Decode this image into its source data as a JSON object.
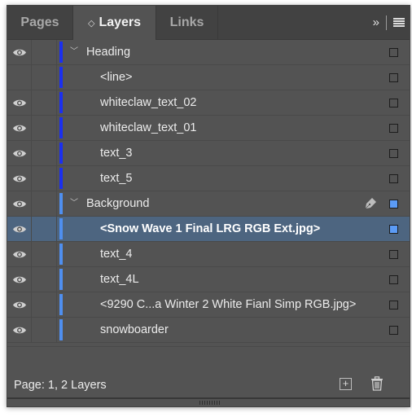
{
  "tabs": [
    {
      "label": "Pages",
      "active": false
    },
    {
      "label": "Layers",
      "active": true,
      "icon": "up-down-arrows-icon"
    },
    {
      "label": "Links",
      "active": false
    }
  ],
  "toolbar": {
    "expand_icon": "»",
    "menu_icon": "hamburger-menu-icon"
  },
  "layers": [
    {
      "name": "Heading",
      "type": "layer",
      "visible": true,
      "expanded": true,
      "color": "#1a2ff0",
      "selection_box": "empty"
    },
    {
      "name": "<line>",
      "type": "item",
      "visible": false,
      "color": "#1a2ff0",
      "selection_box": "empty"
    },
    {
      "name": "whiteclaw_text_02",
      "type": "item",
      "visible": true,
      "color": "#1a2ff0",
      "selection_box": "empty"
    },
    {
      "name": "whiteclaw_text_01",
      "type": "item",
      "visible": true,
      "color": "#1a2ff0",
      "selection_box": "empty"
    },
    {
      "name": "text_3",
      "type": "item",
      "visible": true,
      "color": "#1a2ff0",
      "selection_box": "empty"
    },
    {
      "name": "text_5",
      "type": "item",
      "visible": true,
      "color": "#1a2ff0",
      "selection_box": "empty"
    },
    {
      "name": "Background",
      "type": "layer",
      "visible": true,
      "expanded": true,
      "color": "#4f8ff0",
      "selection_box": "filled",
      "pen": true
    },
    {
      "name": "<Snow Wave 1 Final LRG RGB Ext.jpg>",
      "type": "item",
      "visible": true,
      "color": "#4f8ff0",
      "selection_box": "filled",
      "selected": true
    },
    {
      "name": "text_4",
      "type": "item",
      "visible": true,
      "color": "#4f8ff0",
      "selection_box": "empty"
    },
    {
      "name": "text_4L",
      "type": "item",
      "visible": true,
      "color": "#4f8ff0",
      "selection_box": "empty"
    },
    {
      "name": "<9290 C...a Winter 2 White Fianl Simp RGB.jpg>",
      "type": "item",
      "visible": true,
      "color": "#4f8ff0",
      "selection_box": "empty"
    },
    {
      "name": "snowboarder",
      "type": "item",
      "visible": true,
      "color": "#4f8ff0",
      "selection_box": "empty"
    }
  ],
  "footer": {
    "status": "Page: 1, 2 Layers",
    "add_button": "+",
    "add_icon": "new-layer-icon",
    "delete_icon": "trash-icon"
  },
  "colors": {
    "panel_bg": "#535353",
    "selected_row": "#4d6580",
    "heading_layer_color": "#1a2ff0",
    "background_layer_color": "#4f8ff0"
  }
}
